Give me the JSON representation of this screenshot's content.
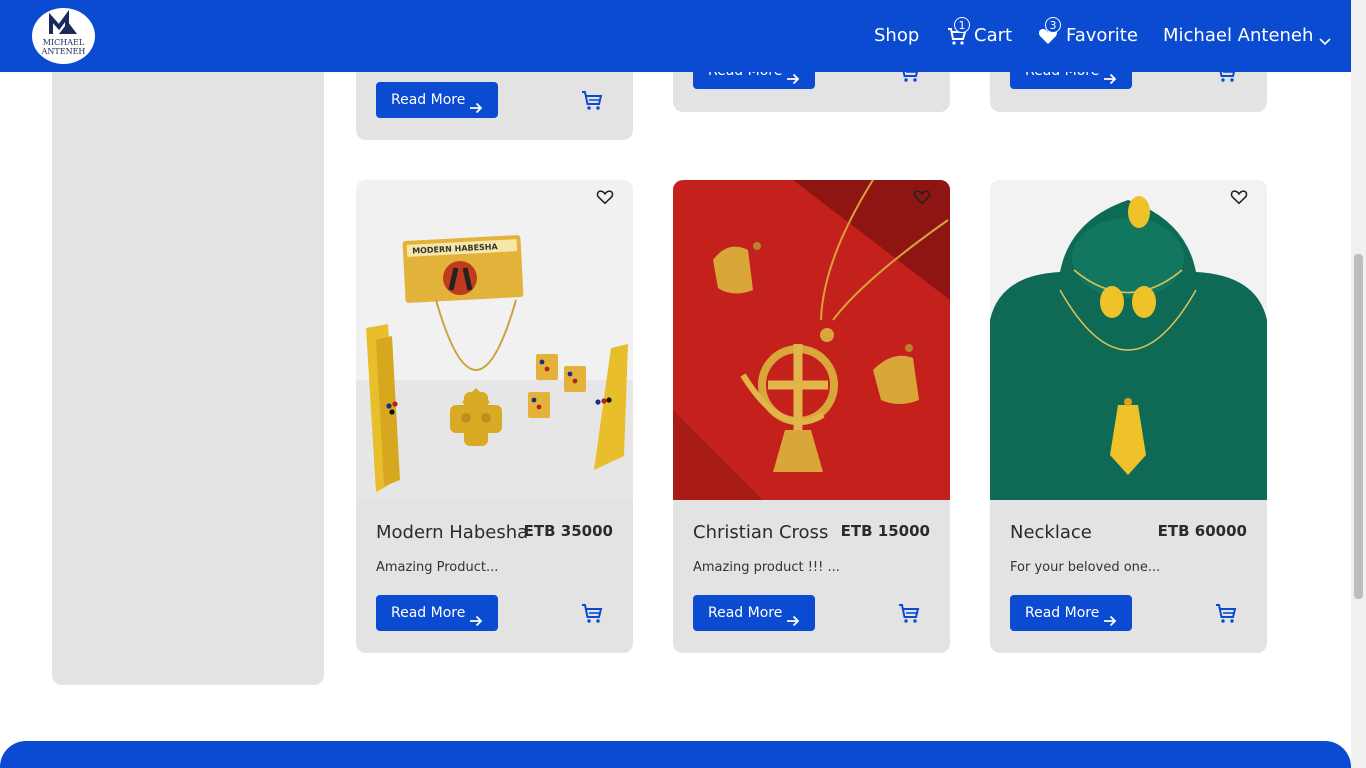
{
  "brand": {
    "logo_line1": "MICHAEL",
    "logo_line2": "ANTENEH"
  },
  "nav": {
    "shop_label": "Shop",
    "cart_label": "Cart",
    "cart_count": "1",
    "favorite_label": "Favorite",
    "favorite_count": "3",
    "user_label": "Michael Anteneh"
  },
  "top_cards": [
    {
      "read_more": "Read More"
    },
    {
      "read_more": "Read More"
    },
    {
      "read_more": "Read More"
    }
  ],
  "products": [
    {
      "title": "Modern Habesha",
      "price": "ETB 35000",
      "description": "Amazing Product...",
      "read_more": "Read More",
      "image_text": "MODERN HABESHA"
    },
    {
      "title": "Christian Cross",
      "price": "ETB 15000",
      "description": "Amazing product !!! ...",
      "read_more": "Read More"
    },
    {
      "title": "Necklace",
      "price": "ETB 60000",
      "description": "For your beloved one...",
      "read_more": "Read More"
    }
  ],
  "colors": {
    "primary": "#0a4bd1",
    "card_bg": "#e3e3e3"
  }
}
